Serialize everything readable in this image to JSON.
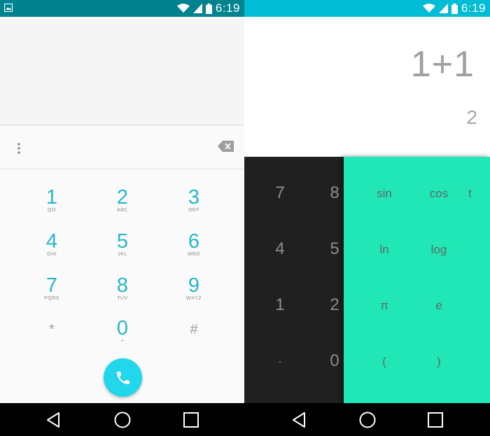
{
  "status_bar": {
    "time": "6:19"
  },
  "dialer": {
    "keys": [
      {
        "digit": "1",
        "letters": "QO"
      },
      {
        "digit": "2",
        "letters": "ABC"
      },
      {
        "digit": "3",
        "letters": "DEF"
      },
      {
        "digit": "4",
        "letters": "GHI"
      },
      {
        "digit": "5",
        "letters": "JKL"
      },
      {
        "digit": "6",
        "letters": "MNO"
      },
      {
        "digit": "7",
        "letters": "PQRS"
      },
      {
        "digit": "8",
        "letters": "TUV"
      },
      {
        "digit": "9",
        "letters": "WXYZ"
      },
      {
        "digit": "*",
        "letters": ""
      },
      {
        "digit": "0",
        "letters": "+"
      },
      {
        "digit": "#",
        "letters": ""
      }
    ]
  },
  "calculator": {
    "formula": "1+1",
    "result": "2",
    "digits": [
      "7",
      "8",
      "4",
      "5",
      "1",
      "2",
      ".",
      "0"
    ],
    "advanced": [
      "sin",
      "cos",
      "t",
      "ln",
      "log",
      "π",
      "e",
      "(",
      ")"
    ]
  }
}
